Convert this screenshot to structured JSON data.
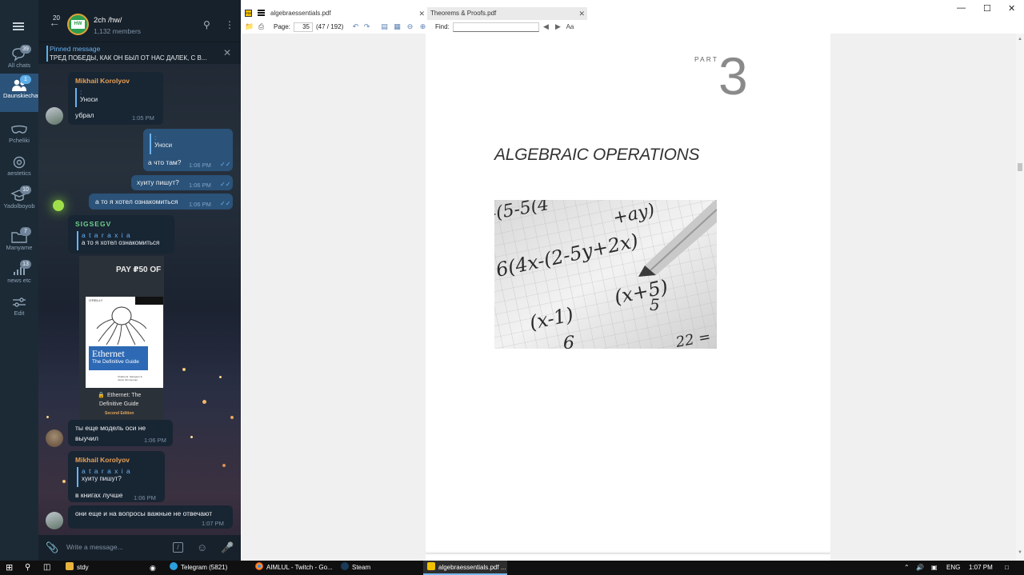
{
  "telegram": {
    "folders": [
      {
        "label": "All chats",
        "badge": "39",
        "icon": "chats-icon"
      },
      {
        "label": "Daunskiechat",
        "badge": "1",
        "icon": "people-icon",
        "active": true
      },
      {
        "label": "Pcheliki",
        "badge": "",
        "icon": "mask-icon"
      },
      {
        "label": "aestetics",
        "badge": "",
        "icon": "gear-icon"
      },
      {
        "label": "Yadolboyob",
        "badge": "10",
        "icon": "graduation-icon"
      },
      {
        "label": "Manyame",
        "badge": "7",
        "icon": "folder-icon"
      },
      {
        "label": "news etc",
        "badge": "13",
        "icon": "signal-icon"
      },
      {
        "label": "Edit",
        "badge": "",
        "icon": "sliders-icon"
      }
    ],
    "header": {
      "back_count": "20",
      "avatar_text": "HW",
      "title": "2ch /hw/",
      "subtitle": "1,132 members"
    },
    "pinned": {
      "title": "Pinned message",
      "text": "ТРЕД ПОБЕДЫ, КАК ОН БЫЛ ОТ НАС ДАЛЕК, С В..."
    },
    "messages": {
      "m1": {
        "sender": "Mikhail Korolyov",
        "quote_name": ":",
        "quote_text": "Уноси",
        "text": "убрал",
        "time": "1:05 PM"
      },
      "m2": {
        "quote_name": ":",
        "quote_text": "Уноси",
        "text": "а что там?",
        "time": "1:06 PM"
      },
      "m3": {
        "text": "хуиту пишут?",
        "time": "1:06 PM"
      },
      "m4": {
        "text": "а то я хотел ознакомиться",
        "time": "1:06 PM"
      },
      "m5": {
        "sender": "SIGSEGV",
        "quote_name": "a t a r a x i a",
        "quote_text": "а то я хотел ознакомиться",
        "image": {
          "pay": "PAY ₽50 OF",
          "book_publisher": "O'REILLY",
          "book_title": "Ethernet",
          "book_subtitle": "The Definitive Guide",
          "book_authors": "Charles E. Spurgeon & Joann Zimmerman",
          "caption_line1": "Ethernet: The",
          "caption_line2": "Definitive Guide",
          "caption_edition": "Second Edition"
        }
      },
      "m6": {
        "text_line1": "ты еще модель оси не",
        "text_line2": "выучил",
        "time": "1:06 PM"
      },
      "m7": {
        "sender": "Mikhail Korolyov",
        "quote_name": "a t a r a x i a",
        "quote_text": "хуиту пишут?",
        "text": "в книгах лучше",
        "time": "1:06 PM"
      },
      "m8": {
        "text": "они еще и на вопросы важные не отвечают",
        "time": "1:07 PM"
      }
    },
    "composer": {
      "placeholder": "Write a message..."
    }
  },
  "pdf": {
    "tabs": [
      {
        "label": "algebraessentials.pdf",
        "active": true
      },
      {
        "label": "Theorems & Proofs.pdf",
        "active": false
      }
    ],
    "toolbar": {
      "page_label": "Page:",
      "page_value": "35",
      "page_total": "(47 / 192)",
      "find_label": "Find:"
    },
    "page": {
      "part_label": "PART",
      "part_number": "3",
      "chapter_title": "ALGEBRAIC OPERATIONS",
      "image_equations": {
        "line1": "-(5-5(4",
        "line2": "+ay)",
        "line3": "6(4x-(2-5y+2x)",
        "line4": "(x-1)",
        "line5": "(x+5)",
        "line6": "6",
        "line7": "5",
        "line8": "22 ="
      }
    }
  },
  "taskbar": {
    "items": [
      {
        "label": "stdy",
        "active": false
      },
      {
        "label": "Telegram (5821)",
        "active": false
      },
      {
        "label": "AIMLUL - Twitch - Go...",
        "active": false
      },
      {
        "label": "Steam",
        "active": false
      },
      {
        "label": "algebraessentials.pdf ...",
        "active": true
      }
    ],
    "tray": {
      "lang": "ENG",
      "time": "1:07 PM"
    }
  },
  "colors": {
    "telegram_sidebar": "#1c2a36",
    "telegram_header": "#17212b",
    "outgoing_bubble": "#2b5278",
    "incoming_bubble": "#182533",
    "accent": "#5eaee8",
    "sender_orange": "#e9a055",
    "sender_green": "#6ed28b"
  }
}
